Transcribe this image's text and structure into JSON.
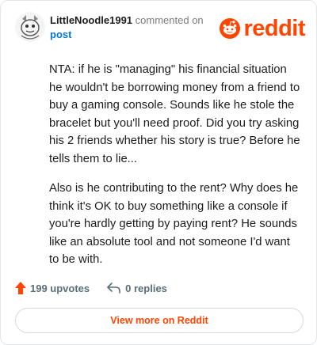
{
  "comment": {
    "username": "LittleNoodle1991",
    "action_text": "commented on",
    "post_link_label": "post",
    "paragraphs": [
      "NTA: if he is \"managing\" his financial situation he wouldn't be borrowing money from a friend to buy a gaming console. Sounds like he stole the bracelet but you'll need proof. Did you try asking his 2 friends whether his story is true? Before he tells them to lie...",
      "Also is he contributing to the rent? Why does he think it's OK to buy something like a console if you're hardly getting by paying rent? He sounds like an absolute tool and not someone I'd want to be with."
    ]
  },
  "brand": {
    "logo_text": "reddit",
    "color": "#ff4500"
  },
  "footer": {
    "upvotes": "199 upvotes",
    "replies": "0 replies",
    "view_more": "View more on Reddit"
  },
  "icons": {
    "avatar": "snoo-avatar",
    "logo": "reddit-snoo-icon",
    "upvote": "upvote-arrow-icon",
    "reply": "reply-arrow-icon"
  }
}
